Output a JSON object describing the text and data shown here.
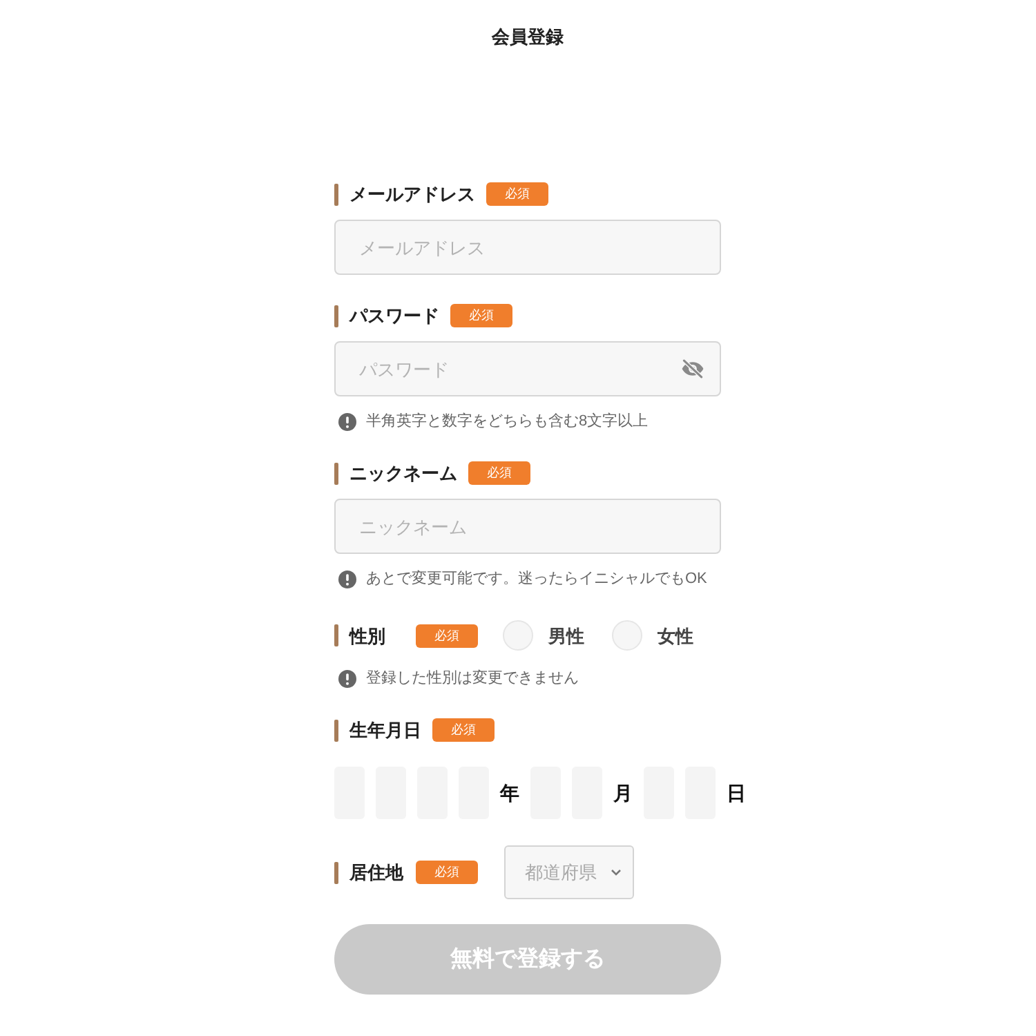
{
  "page": {
    "title": "会員登録"
  },
  "fields": [
    {
      "kind": "text",
      "label": "メールアドレス",
      "badge": "必須",
      "placeholder": "メールアドレス"
    },
    {
      "kind": "password",
      "label": "パスワード",
      "badge": "必須",
      "placeholder": "パスワード",
      "hint": "半角英字と数字をどちらも含む8文字以上"
    },
    {
      "kind": "text",
      "label": "ニックネーム",
      "badge": "必須",
      "placeholder": "ニックネーム",
      "hint": "あとで変更可能です。迷ったらイニシャルでもOK"
    },
    {
      "kind": "radio",
      "label": "性別",
      "badge": "必須",
      "options": [
        {
          "label": "男性",
          "selected": false
        },
        {
          "label": "女性",
          "selected": false
        }
      ],
      "hint": "登録した性別は変更できません"
    },
    {
      "kind": "date",
      "label": "生年月日",
      "badge": "必須",
      "segments": [
        {
          "kind": "year",
          "unit": "年"
        },
        {
          "kind": "month",
          "unit": "月"
        },
        {
          "kind": "day",
          "unit": "日"
        }
      ]
    },
    {
      "kind": "select",
      "label": "居住地",
      "badge": "必須",
      "placeholder": "都道府県"
    }
  ],
  "submit": {
    "label": "無料で登録する",
    "disabled": true
  }
}
